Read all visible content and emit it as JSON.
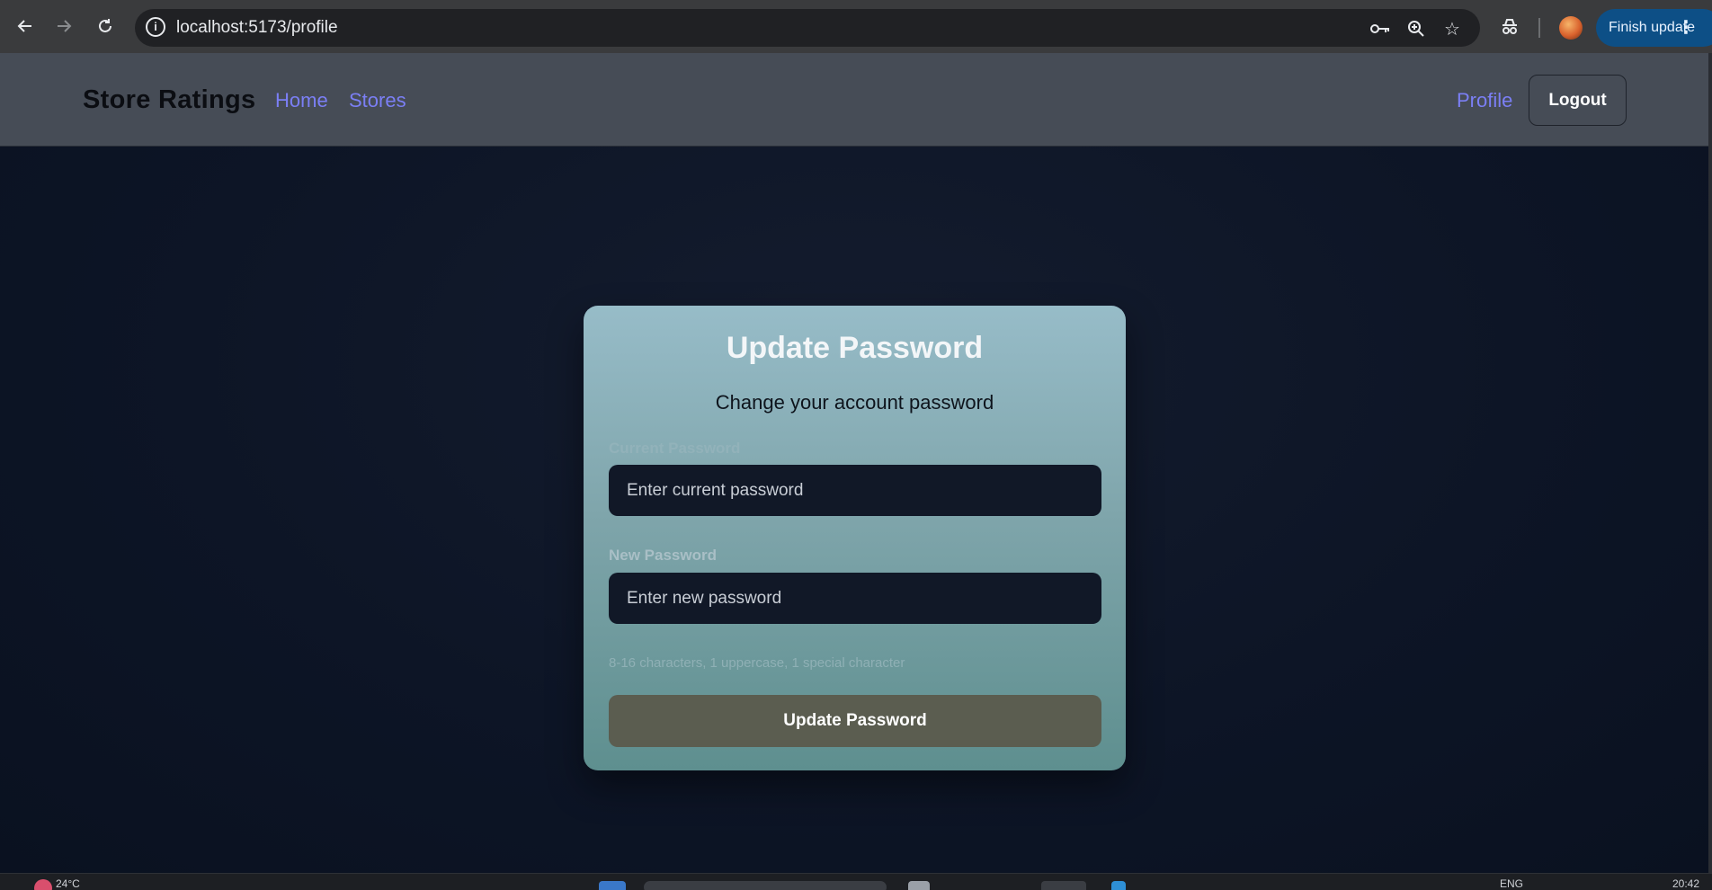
{
  "browser": {
    "url": "localhost:5173/profile",
    "finish_update_label": "Finish update",
    "icons": [
      "back-arrow-icon",
      "forward-arrow-icon",
      "reload-icon",
      "site-info-icon",
      "password-key-icon",
      "zoom-icon",
      "bookmark-star-icon",
      "incognito-icon",
      "profile-avatar",
      "more-vert-icon"
    ],
    "accent_color": "#0d4f86"
  },
  "navbar": {
    "brand": "Store Ratings",
    "links": [
      "Home",
      "Stores"
    ],
    "profile_link": "Profile",
    "logout_label": "Logout",
    "link_color": "#7b7ff5"
  },
  "card": {
    "title": "Update Password",
    "subtitle": "Change your account password",
    "current_password": {
      "label": "Current Password",
      "placeholder": "Enter current password",
      "value": ""
    },
    "new_password": {
      "label": "New Password",
      "placeholder": "Enter new password",
      "value": ""
    },
    "hint": "8-16 characters, 1 uppercase, 1 special character",
    "submit_label": "Update Password"
  },
  "taskbar": {
    "temperature": "24°C",
    "language": "ENG",
    "time": "20:42"
  }
}
